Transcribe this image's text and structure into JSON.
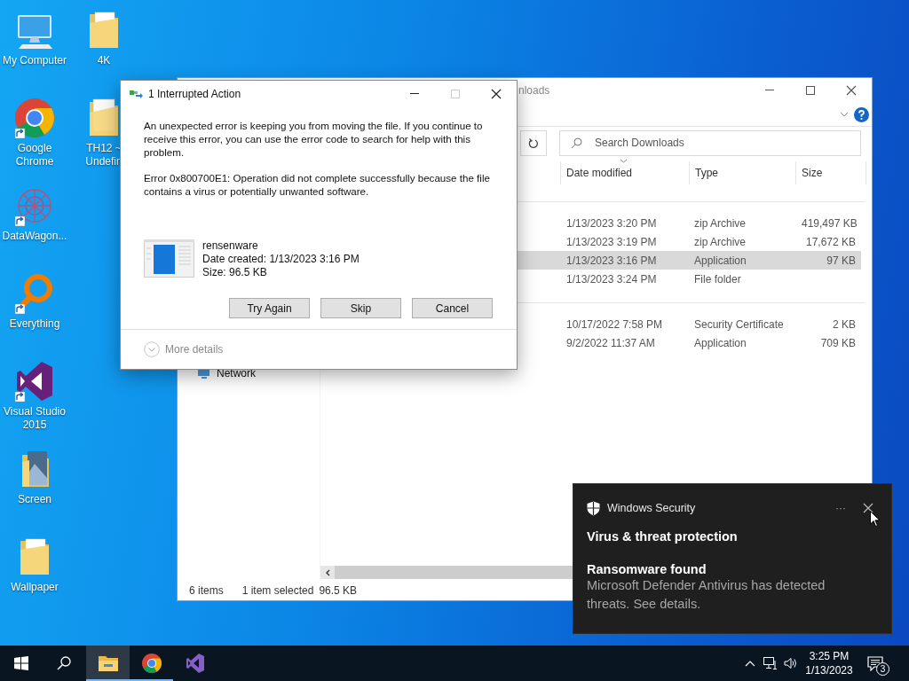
{
  "desktop_icons": {
    "columns": [
      [
        {
          "label": "My Computer",
          "kind": "computer",
          "shortcut": false
        },
        {
          "label": "Google Chrome",
          "kind": "browser",
          "shortcut": true
        },
        {
          "label": "DataWagon...",
          "kind": "pattern",
          "shortcut": true
        },
        {
          "label": "Everything",
          "kind": "magnifier",
          "shortcut": true
        },
        {
          "label": "Visual Studio 2015",
          "kind": "studio",
          "shortcut": true
        },
        {
          "label": "Screen",
          "kind": "photo-folder",
          "shortcut": false
        },
        {
          "label": "Wallpaper",
          "kind": "folder",
          "shortcut": false
        }
      ],
      [
        {
          "label": "4K",
          "kind": "folder",
          "shortcut": false
        },
        {
          "label": "TH12 ~ Undefin",
          "kind": "doc-folder",
          "shortcut": false
        }
      ]
    ]
  },
  "explorer": {
    "title": "nloads",
    "search": {
      "placeholder": "Search Downloads"
    },
    "columns": [
      {
        "label": "Date modified",
        "sorted": true
      },
      {
        "label": "Type",
        "sorted": false
      },
      {
        "label": "Size",
        "sorted": false
      }
    ],
    "groups": [
      {
        "rows": [
          {
            "date": "1/13/2023 3:20 PM",
            "type": "zip Archive",
            "size": "419,497 KB",
            "selected": false
          },
          {
            "date": "1/13/2023 3:19 PM",
            "type": "zip Archive",
            "size": "17,672 KB",
            "selected": false
          },
          {
            "date": "1/13/2023 3:16 PM",
            "type": "Application",
            "size": "97 KB",
            "selected": true
          },
          {
            "date": "1/13/2023 3:24 PM",
            "type": "File folder",
            "selected": false
          }
        ]
      },
      {
        "rows": [
          {
            "date": "10/17/2022 7:58 PM",
            "type": "Security Certificate",
            "size": "2 KB",
            "selected": false
          },
          {
            "date": "9/2/2022 11:37 AM",
            "type": "Application",
            "size": "709 KB",
            "selected": false
          }
        ]
      }
    ],
    "nav_items": [
      {
        "label": "Network"
      }
    ],
    "status": {
      "items": "6 items",
      "selection": "1 item selected",
      "size": "96.5 KB"
    }
  },
  "dialog": {
    "title": "1 Interrupted Action",
    "message": "An unexpected error is keeping you from moving the file. If you continue to receive this error, you can use the error code to search for help with this problem.",
    "error": "Error 0x800700E1: Operation did not complete successfully because the file contains a virus or potentially unwanted software.",
    "file": {
      "name": "rensenware",
      "date_created": "Date created: 1/13/2023 3:16 PM",
      "size": "Size: 96.5 KB"
    },
    "buttons": [
      "Try Again",
      "Skip",
      "Cancel"
    ],
    "details_toggle": "More details"
  },
  "toast": {
    "app": "Windows Security",
    "menu": "···",
    "title": "Virus & threat protection",
    "heading": "Ransomware found",
    "body": "Microsoft Defender Antivirus has detected threats.  See details."
  },
  "taskbar": {
    "apps": [
      {
        "kind": "explorer",
        "open": true,
        "active": true
      },
      {
        "kind": "browser",
        "open": true,
        "active": false
      },
      {
        "kind": "studio",
        "open": false,
        "active": false
      }
    ],
    "clock": {
      "time": "3:25 PM",
      "date": "1/13/2023"
    },
    "notifications": "3"
  }
}
